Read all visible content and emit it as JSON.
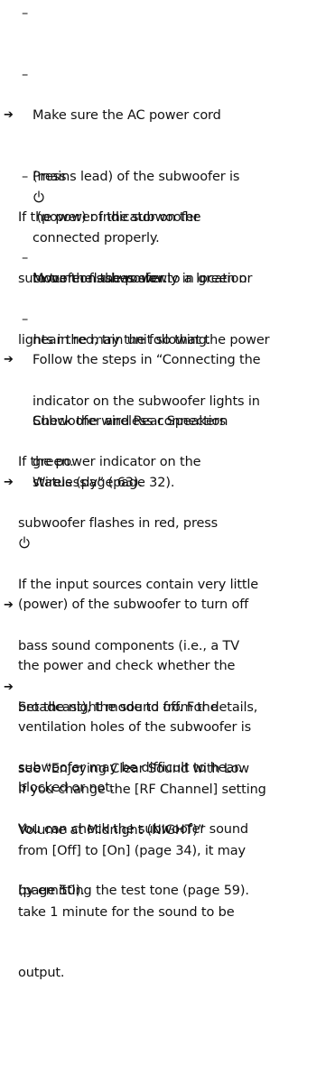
{
  "bullets": {
    "dash": "–",
    "arrow": "➔"
  },
  "icons": {
    "power": "power-icon"
  },
  "items": [
    {
      "kind": "dash",
      "lines": [
        "Make sure the AC power cord",
        "(mains lead) of the subwoofer is",
        "connected properly."
      ]
    },
    {
      "kind": "dash",
      "line1_before": "Press ",
      "line1_after": " (power) of the subwoofer",
      "line2": "to turn on the power."
    },
    {
      "kind": "arrow",
      "lines": [
        "If the power indicator on the",
        "subwoofer flashes slowly in green or",
        "lights in red, try the following."
      ]
    },
    {
      "kind": "dash",
      "lines": [
        "Move the subwoofer to a location",
        "near the main unit so that the power",
        "indicator on the subwoofer lights in",
        "green."
      ]
    },
    {
      "kind": "dash",
      "lines": [
        "Follow the steps in “Connecting the",
        "Subwoofer and Rear Speakers",
        "Wirelessly” (page 32)."
      ]
    },
    {
      "kind": "dash",
      "lines": [
        "Check the wireless connection",
        "status (page 63)."
      ]
    },
    {
      "kind": "arrow",
      "line1": "If the power indicator on the",
      "line2_before": "subwoofer flashes in red, press ",
      "line3": "(power) of the subwoofer to turn off",
      "line4": "the power and check whether the",
      "line5": "ventilation holes of the subwoofer is",
      "line6": "blocked or not."
    },
    {
      "kind": "arrow",
      "lines": [
        "If the input sources contain very little",
        "bass sound components (i.e., a TV",
        "broadcast), the sound from the",
        "subwoofer may be difficult to hear.",
        "You can check the subwoofer sound",
        "by emitting the test tone (page 59)."
      ]
    },
    {
      "kind": "arrow",
      "lines": [
        "Set the night mode to off. For details,",
        "see “Enjoying Clear Sound with Low",
        "Volume at Midnight (NIGHT)”",
        "(page 50)."
      ]
    },
    {
      "kind": "arrow",
      "lines": [
        "If you change the [RF Channel] setting",
        "from [Off] to [On] (page 34), it may",
        "take 1 minute for the sound to be",
        "output."
      ]
    }
  ]
}
